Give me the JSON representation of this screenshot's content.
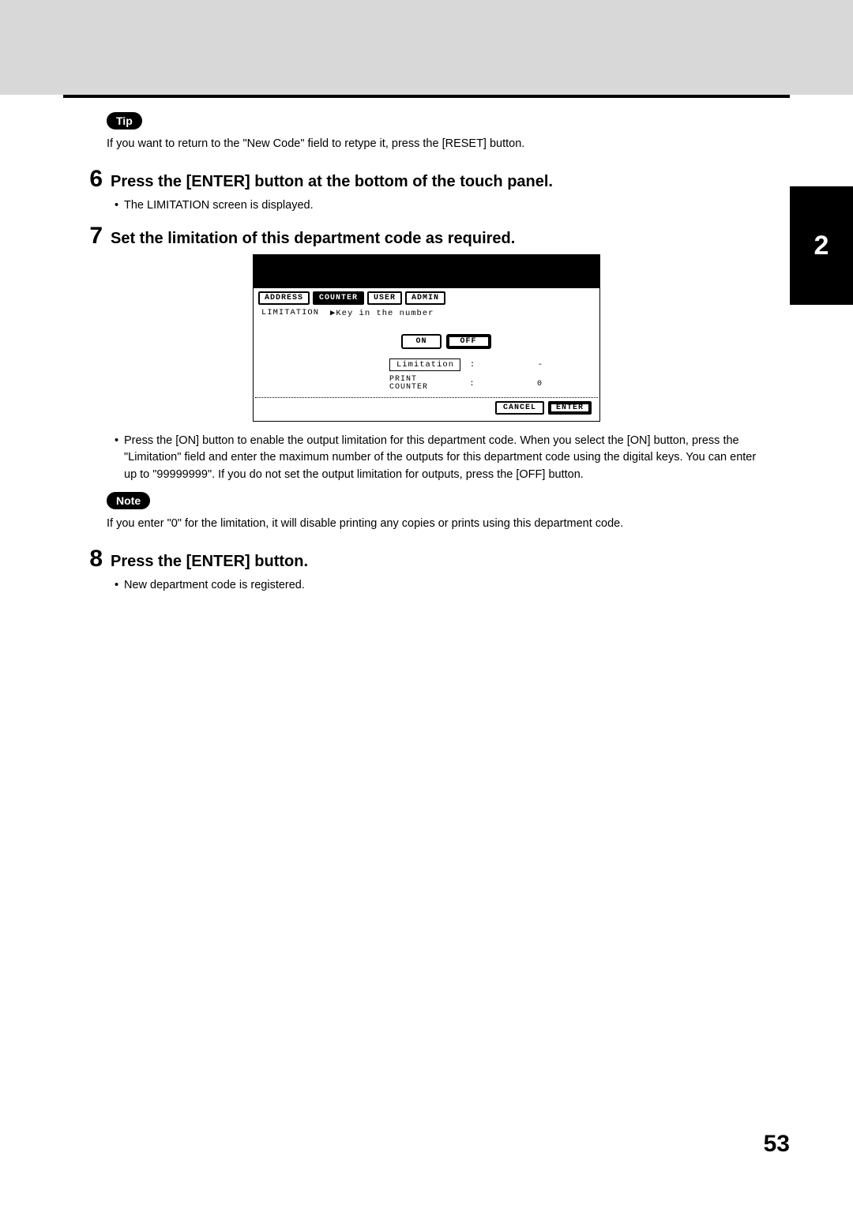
{
  "chapter_tab": "2",
  "page_number": "53",
  "tip_label": "Tip",
  "tip_text": "If you want to return to the \"New Code\" field to retype it, press the [RESET] button.",
  "steps": {
    "s6": {
      "num": "6",
      "title": "Press the [ENTER] button at the bottom of the touch panel.",
      "bullet": "The LIMITATION screen is displayed."
    },
    "s7": {
      "num": "7",
      "title": "Set the limitation of this department code as required.",
      "bullet": "Press the [ON] button to enable the output limitation for this department code. When you select the [ON] button, press the \"Limitation\" field and enter the maximum number of the outputs for this department code using the digital keys. You can enter up to \"99999999\". If you do not set the output limitation for outputs, press the [OFF] button."
    },
    "s8": {
      "num": "8",
      "title": "Press the [ENTER] button.",
      "bullet": "New department code is registered."
    }
  },
  "note_label": "Note",
  "note_text": "If you enter \"0\" for the limitation, it will disable printing any copies or prints using this department code.",
  "screen": {
    "tabs": {
      "address": "ADDRESS",
      "counter": "COUNTER",
      "user": "USER",
      "admin": "ADMIN"
    },
    "line1_left": "LIMITATION",
    "line1_right": "▶Key in the number",
    "on": "ON",
    "off": "OFF",
    "limitation_label": "Limitation",
    "colon": ":",
    "dash": "-",
    "print_counter_label_l1": "PRINT",
    "print_counter_label_l2": "COUNTER",
    "print_counter_val": "0",
    "cancel": "CANCEL",
    "enter": "ENTER"
  }
}
